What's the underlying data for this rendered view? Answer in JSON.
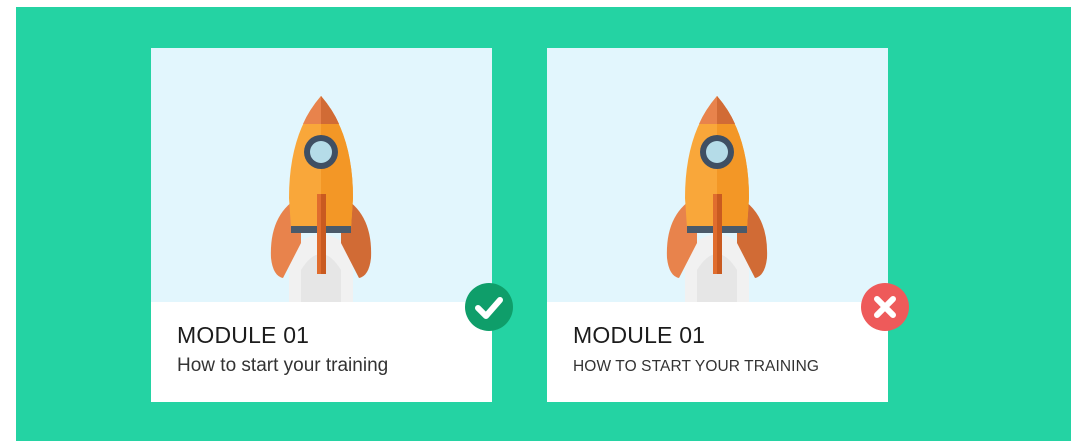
{
  "colors": {
    "background": "#24d3a3",
    "art_background": "#e2f6fd",
    "correct": "#0f9e6a",
    "incorrect": "#ee5a5a"
  },
  "cards": [
    {
      "illustration": "rocket-icon",
      "title": "MODULE 01",
      "subtitle": "How to start your training",
      "status_icon": "checkmark-icon",
      "status": "correct"
    },
    {
      "illustration": "rocket-icon",
      "title": "MODULE 01",
      "subtitle": "HOW TO START YOUR TRAINING",
      "status_icon": "cross-icon",
      "status": "incorrect"
    }
  ]
}
